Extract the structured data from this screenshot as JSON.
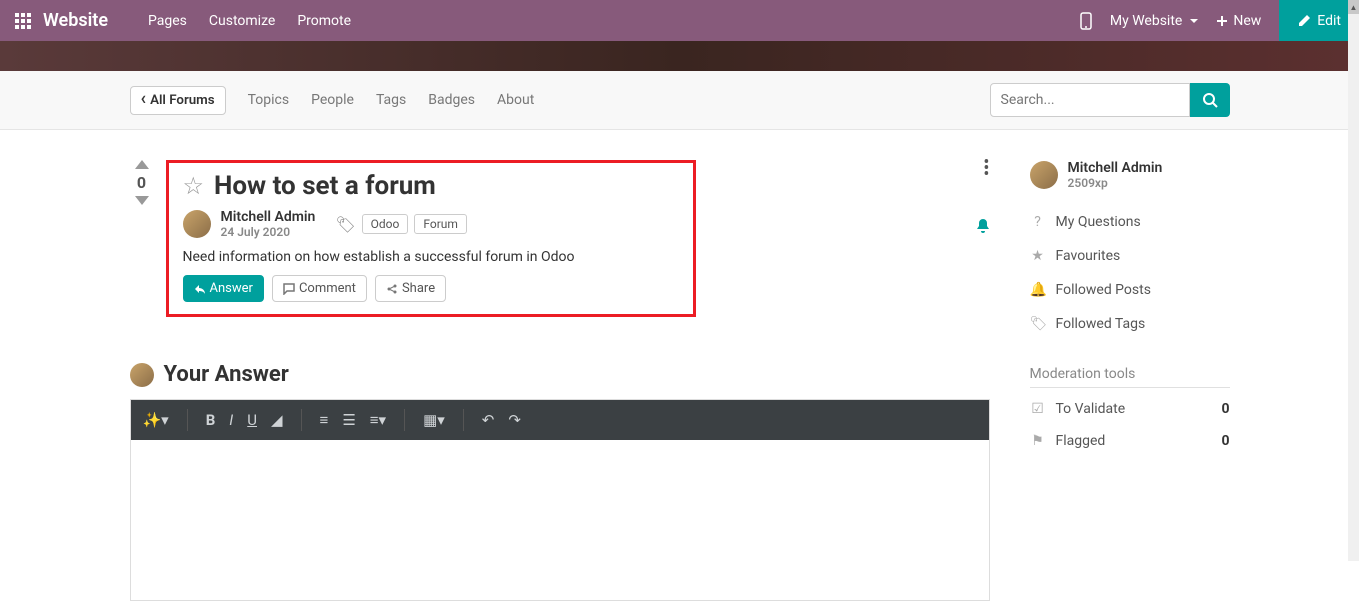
{
  "nav": {
    "brand": "Website",
    "links": [
      "Pages",
      "Customize",
      "Promote"
    ],
    "site_selector": "My Website",
    "new_label": "New",
    "edit_label": "Edit"
  },
  "subnav": {
    "all_forums": "All Forums",
    "links": [
      "Topics",
      "People",
      "Tags",
      "Badges",
      "About"
    ],
    "search_placeholder": "Search..."
  },
  "question": {
    "vote_count": "0",
    "title": "How to set a forum",
    "author": "Mitchell Admin",
    "date": "24 July 2020",
    "tags": [
      "Odoo",
      "Forum"
    ],
    "body": "Need information on how establish a successful forum in Odoo",
    "actions": {
      "answer": "Answer",
      "comment": "Comment",
      "share": "Share"
    }
  },
  "answer": {
    "heading": "Your Answer"
  },
  "sidebar": {
    "profile": {
      "name": "Mitchell Admin",
      "xp": "2509xp"
    },
    "links": [
      "My Questions",
      "Favourites",
      "Followed Posts",
      "Followed Tags"
    ],
    "mod_title": "Moderation tools",
    "mod": [
      {
        "label": "To Validate",
        "count": "0"
      },
      {
        "label": "Flagged",
        "count": "0"
      }
    ]
  }
}
